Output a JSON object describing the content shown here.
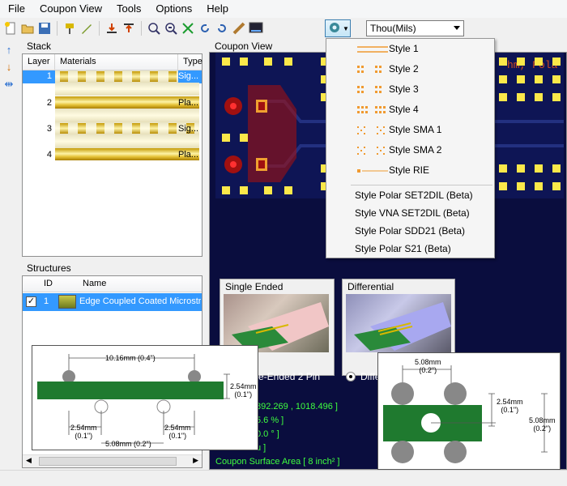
{
  "menu": [
    "File",
    "Coupon View",
    "Tools",
    "Options",
    "Help"
  ],
  "toolbar": {
    "icons": [
      "new-file-icon",
      "open-folder-icon",
      "save-icon",
      "probe-icon",
      "pencil-icon",
      "import-icon",
      "export-icon",
      "zoom-in-icon",
      "zoom-out-icon",
      "fit-icon",
      "rotate-left-icon",
      "rotate-right-icon",
      "ruler-icon",
      "monitor-icon"
    ],
    "units": "Thou(Mils)"
  },
  "stack": {
    "title": "Stack",
    "columns": [
      "Layer",
      "Materials",
      "Type"
    ],
    "rows": [
      {
        "layer": "1",
        "type": "Sig..."
      },
      {
        "layer": "2",
        "type": "Pla..."
      },
      {
        "layer": "3",
        "type": "Sig..."
      },
      {
        "layer": "4",
        "type": "Pla..."
      }
    ]
  },
  "structures": {
    "title": "Structures",
    "columns": [
      "ID",
      "Name"
    ],
    "row": {
      "id": "1",
      "name": "Edge Coupled Coated Microstrip"
    }
  },
  "coupon": {
    "title": "Coupon View",
    "pcb_text": "hm, Pola",
    "single_title": "Single Ended",
    "single_caption": "e-Ended 2 Pin",
    "diff_title": "Differential",
    "diff_caption": "Diffe",
    "readout": [
      "892.269 , 1018.496 ]",
      "5.6 % ]",
      "0.0 ° ]",
      "u ]",
      "Coupon Surface Area [ 8 inch² ]"
    ]
  },
  "dropdown": {
    "items": [
      "Style 1",
      "Style 2",
      "Style 3",
      "Style 4",
      "Style SMA 1",
      "Style SMA 2",
      "Style RIE"
    ],
    "beta_items": [
      "Style Polar SET2DIL (Beta)",
      "Style VNA SET2DIL (Beta)",
      "Style Polar SDD21 (Beta)",
      "Style Polar S21 (Beta)"
    ]
  },
  "diagram_left": {
    "top": "10.16mm (0.4\")",
    "right": [
      "2.54mm",
      "(0.1\")"
    ],
    "bl": [
      "2.54mm",
      "(0.1\")"
    ],
    "br": [
      "2.54mm",
      "(0.1\")"
    ],
    "bottom": "5.08mm (0.2\")"
  },
  "diagram_right": {
    "top": [
      "5.08mm",
      "(0.2\")"
    ],
    "mid": [
      "2.54mm",
      "(0.1\")"
    ],
    "right": [
      "5.08mm",
      "(0.2\")"
    ]
  },
  "colors": {
    "pcb": "#0e1555",
    "pad": "#fbe84a",
    "board_green": "#1f7a2f",
    "selection": "#3399ff"
  }
}
